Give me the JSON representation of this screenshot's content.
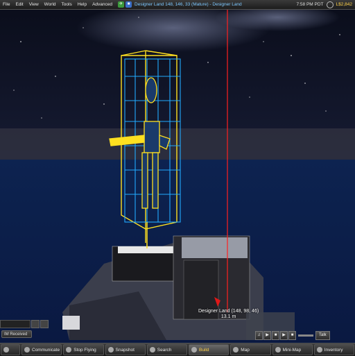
{
  "menubar": {
    "items": [
      "File",
      "Edit",
      "View",
      "World",
      "Tools",
      "Help",
      "Advanced"
    ],
    "location": "Designer Land 148, 146, 33 (Mature) - Designer Land",
    "time": "7:58 PM PDT",
    "balance": "L$2,842"
  },
  "scene": {
    "tag_name": "Designer Land (148, 98, 46)",
    "tag_distance": "13.1 m"
  },
  "chat": {
    "im_tab": "IM Received"
  },
  "media": {
    "talk_label": "Talk",
    "buttons": [
      "♫",
      "▶",
      "■",
      "▶",
      "■"
    ]
  },
  "toolbar": {
    "buttons": [
      {
        "label": "",
        "icon": "speech-icon"
      },
      {
        "label": "Communicate",
        "icon": "chat-icon"
      },
      {
        "label": "Stop Flying",
        "icon": "fly-icon"
      },
      {
        "label": "Snapshot",
        "icon": "camera-icon"
      },
      {
        "label": "Search",
        "icon": "search-icon"
      },
      {
        "label": "Build",
        "icon": "build-icon"
      },
      {
        "label": "Map",
        "icon": "map-icon"
      },
      {
        "label": "Mini-Map",
        "icon": "minimap-icon"
      },
      {
        "label": "Inventory",
        "icon": "inventory-icon"
      }
    ]
  },
  "colors": {
    "wireframe_blue": "#22aaff",
    "wireframe_yellow": "#ffe020",
    "beacon_red": "#ff2020",
    "balance_yellow": "#ffd24a"
  }
}
